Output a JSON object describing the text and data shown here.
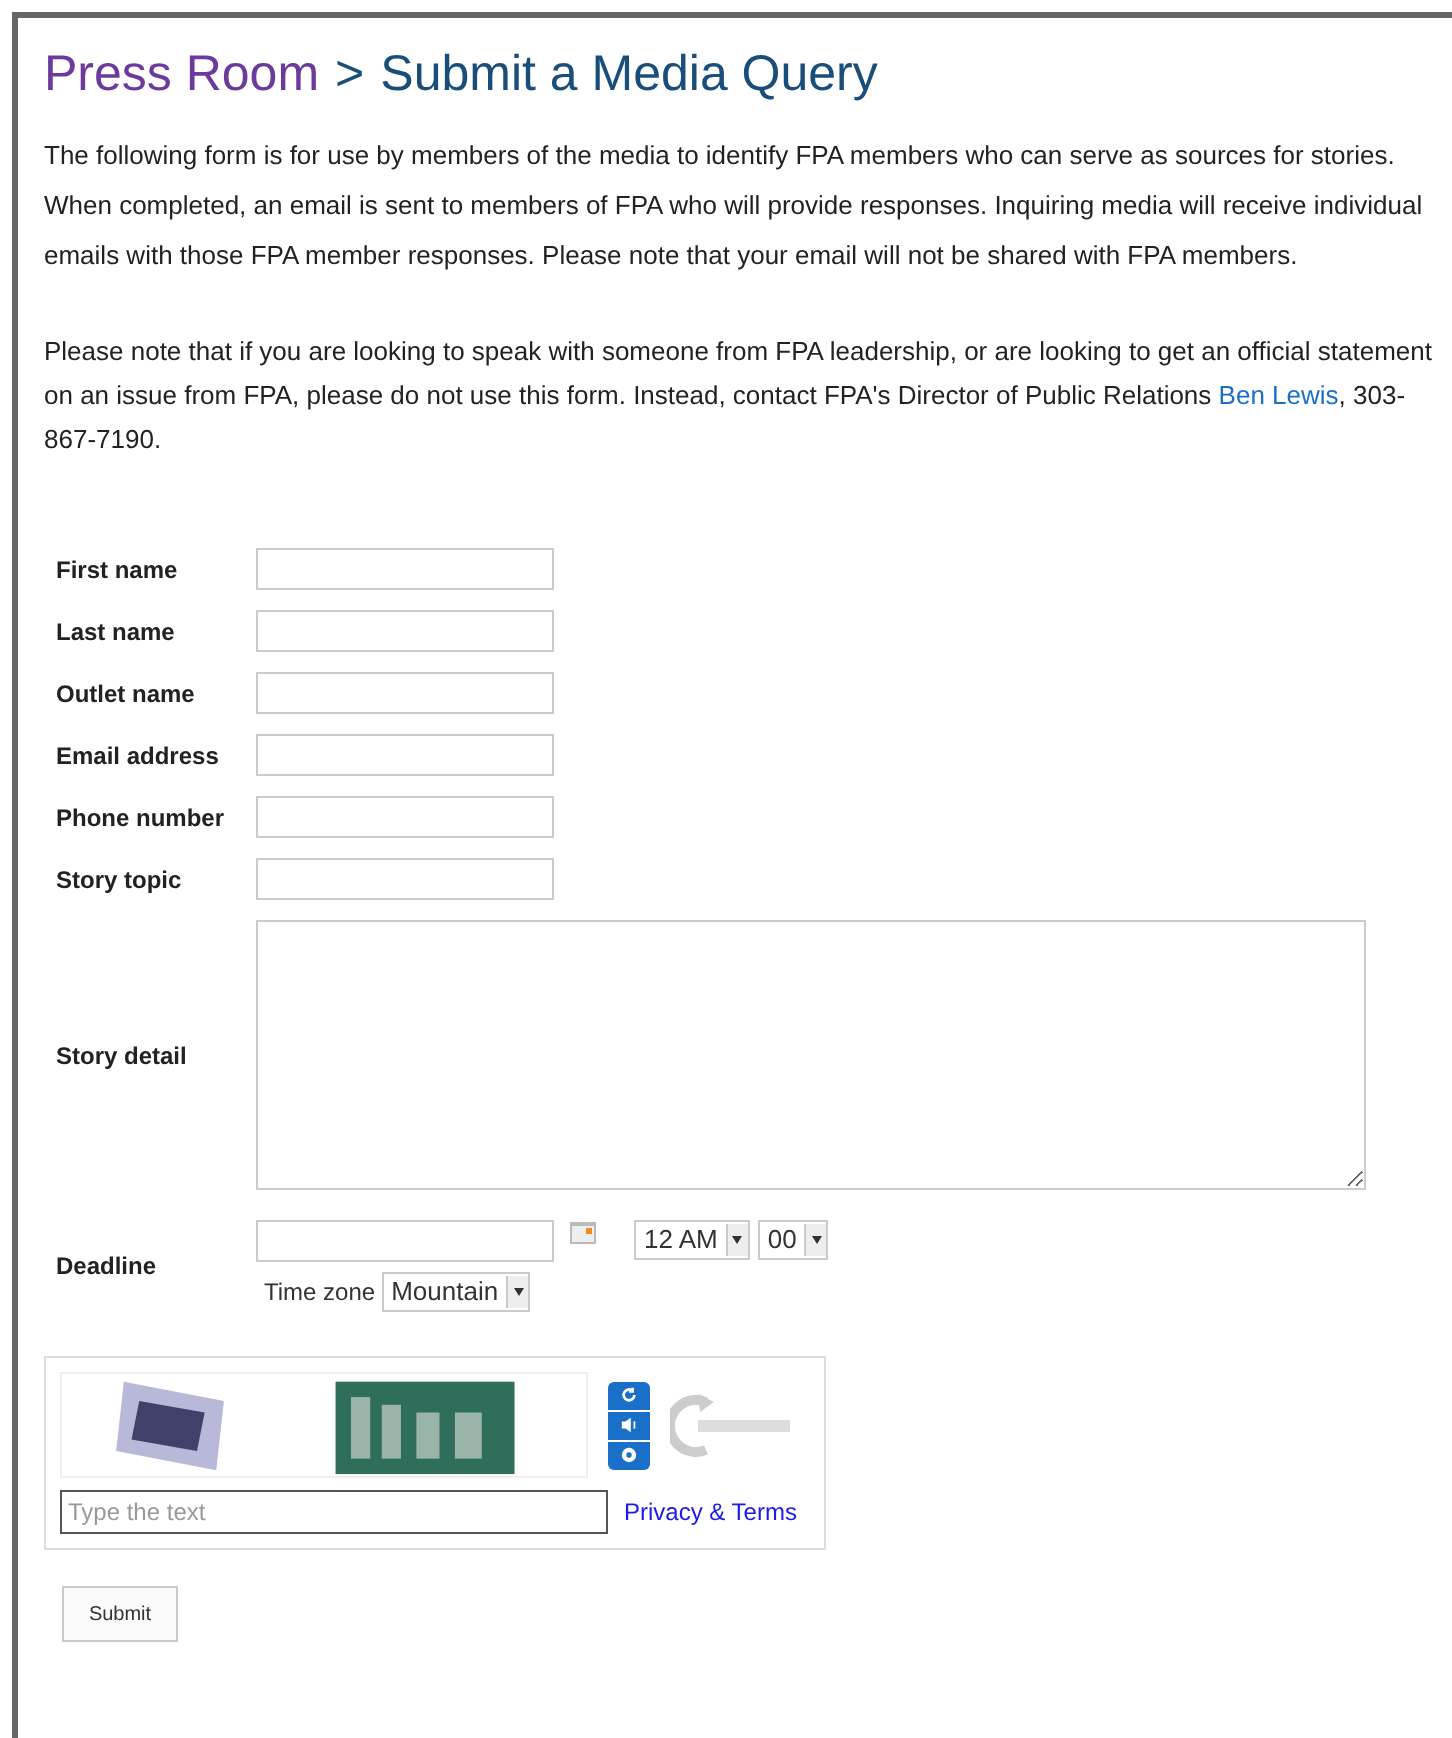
{
  "breadcrumb": {
    "parent": "Press Room",
    "separator": ">",
    "current": "Submit a Media Query"
  },
  "intro": "The following form is for use by members of the media to identify FPA members who can serve as sources for stories. When completed, an email is sent to members of FPA who will provide responses. Inquiring media will receive individual emails with those FPA member responses. Please note that your email will not be shared with FPA members.",
  "note": {
    "text": "Please note that if you are looking to speak with someone from FPA leadership, or are looking to get an official statement on an issue from FPA, please do not use this form. Instead, contact FPA's Director of Public Relations",
    "link": "Ben Lewis",
    "after": ", 303-867-7190."
  },
  "fields": [
    {
      "label": "First name",
      "kind": "text"
    },
    {
      "label": "Last name",
      "kind": "text"
    },
    {
      "label": "Outlet name",
      "kind": "text"
    },
    {
      "label": "Email address",
      "kind": "text"
    },
    {
      "label": "Phone number",
      "kind": "text"
    },
    {
      "label": "Story topic",
      "kind": "text"
    },
    {
      "label": "Story detail",
      "kind": "textarea"
    },
    {
      "label": "Deadline",
      "kind": "datetime",
      "hour": "12 AM",
      "minute": "00",
      "timezone_label": "Time zone",
      "timezone": "Mountain"
    }
  ],
  "captcha": {
    "placeholder": "Type the text",
    "link": "Privacy & Terms"
  },
  "submit": "Submit"
}
